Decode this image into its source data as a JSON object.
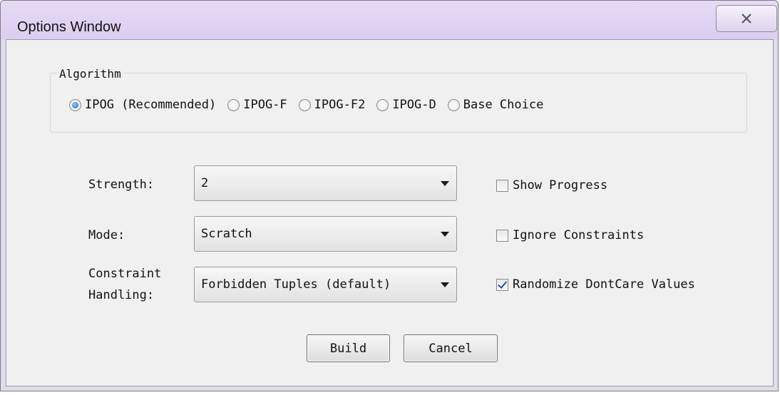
{
  "window": {
    "title": "Options Window",
    "close_icon": "close-icon"
  },
  "algorithm": {
    "legend": "Algorithm",
    "options": [
      {
        "label": "IPOG (Recommended)",
        "selected": true
      },
      {
        "label": "IPOG-F",
        "selected": false
      },
      {
        "label": "IPOG-F2",
        "selected": false
      },
      {
        "label": "IPOG-D",
        "selected": false
      },
      {
        "label": "Base Choice",
        "selected": false
      }
    ]
  },
  "strength": {
    "label": "Strength:",
    "value": "2"
  },
  "mode": {
    "label": "Mode:",
    "value": "Scratch"
  },
  "constraint_handling": {
    "label_line1": "Constraint",
    "label_line2": "Handling:",
    "value": "Forbidden Tuples (default)"
  },
  "checkboxes": {
    "show_progress": {
      "label": "Show Progress",
      "checked": false
    },
    "ignore_constraints": {
      "label": "Ignore Constraints",
      "checked": false
    },
    "randomize_dontcare": {
      "label": "Randomize DontCare Values",
      "checked": true
    }
  },
  "buttons": {
    "build": "Build",
    "cancel": "Cancel"
  }
}
